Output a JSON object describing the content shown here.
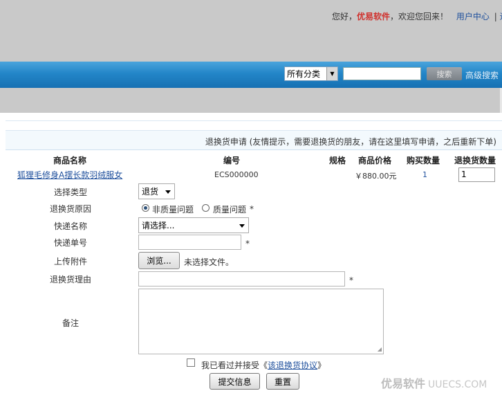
{
  "header": {
    "greeting_prefix": "您好，",
    "brand": "优易软件",
    "greeting_suffix": "，欢迎您回来！",
    "user_center": "用户中心",
    "sep": "|",
    "cut_link": "退"
  },
  "searchbar": {
    "category": "所有分类",
    "search_button": "搜索",
    "advanced_link": "高级搜索"
  },
  "notice": "退换货申请 (友情提示，需要退换货的朋友，请在这里填写申请，之后重新下单)",
  "table": {
    "headers": [
      "商品名称",
      "编号",
      "规格",
      "商品价格",
      "购买数量",
      "退换货数量"
    ],
    "row": {
      "name": "狐狸毛修身A摆长款羽绒服女",
      "code": "ECS000000",
      "spec": "",
      "price": "￥880.00元",
      "qty": "1",
      "return_qty": "1"
    }
  },
  "form": {
    "type_label": "选择类型",
    "type_value": "退货",
    "reason_label": "退换货原因",
    "reason_options": [
      "非质量问题",
      "质量问题"
    ],
    "required_mark": "*",
    "express_label": "快递名称",
    "express_value": "请选择...",
    "tracking_label": "快递单号",
    "upload_label": "上传附件",
    "browse_button": "浏览...",
    "no_file_text": "未选择文件。",
    "reason_text_label": "退换货理由",
    "remark_label": "备注",
    "agree_text": "我已看过并接受《",
    "agree_link": "该退换货协议",
    "agree_end": "》",
    "submit_button": "提交信息",
    "reset_button": "重置"
  },
  "watermark": {
    "text": "优易软件",
    "domain": "UUECS.COM"
  }
}
